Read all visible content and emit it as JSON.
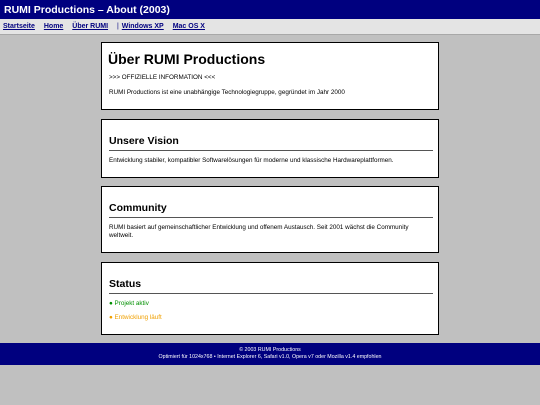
{
  "window": {
    "title": "RUMI Productions – About (2003)"
  },
  "nav": {
    "items": [
      {
        "label": "Startseite"
      },
      {
        "label": "Home"
      },
      {
        "label": "Über RUMI"
      },
      {
        "label": "Windows XP"
      },
      {
        "label": "Mac OS X"
      }
    ],
    "separator": "|"
  },
  "about": {
    "heading": "Über RUMI Productions",
    "official": ">>> OFFIZIELLE INFORMATION <<<",
    "description": "RUMI Productions ist eine unabhängige Technologiegruppe, gegründet im Jahr 2000"
  },
  "vision": {
    "heading": "Unsere Vision",
    "text": "Entwicklung stabiler, kompatibler Softwarelösungen für moderne und klassische Hardwareplattformen."
  },
  "community": {
    "heading": "Community",
    "text": "RUMI basiert auf gemeinschaftlicher Entwicklung und offenem Austausch. Seit 2001 wächst die Community weltweit."
  },
  "status": {
    "heading": "Status",
    "items": [
      {
        "label": "● Projekt aktiv",
        "color": "#009000"
      },
      {
        "label": "● Entwicklung läuft",
        "color": "#f0a000"
      }
    ]
  },
  "footer": {
    "copyright": "© 2003 RUMI Productions",
    "optimized": "Optimiert für 1024x768 • Internet Explorer 6, Safari v1.0, Opera v7 oder Mozilla v1.4 empfohlen"
  },
  "colors": {
    "titlebar": "#00007f",
    "background": "#c0c0c0",
    "link": "#00007f"
  }
}
